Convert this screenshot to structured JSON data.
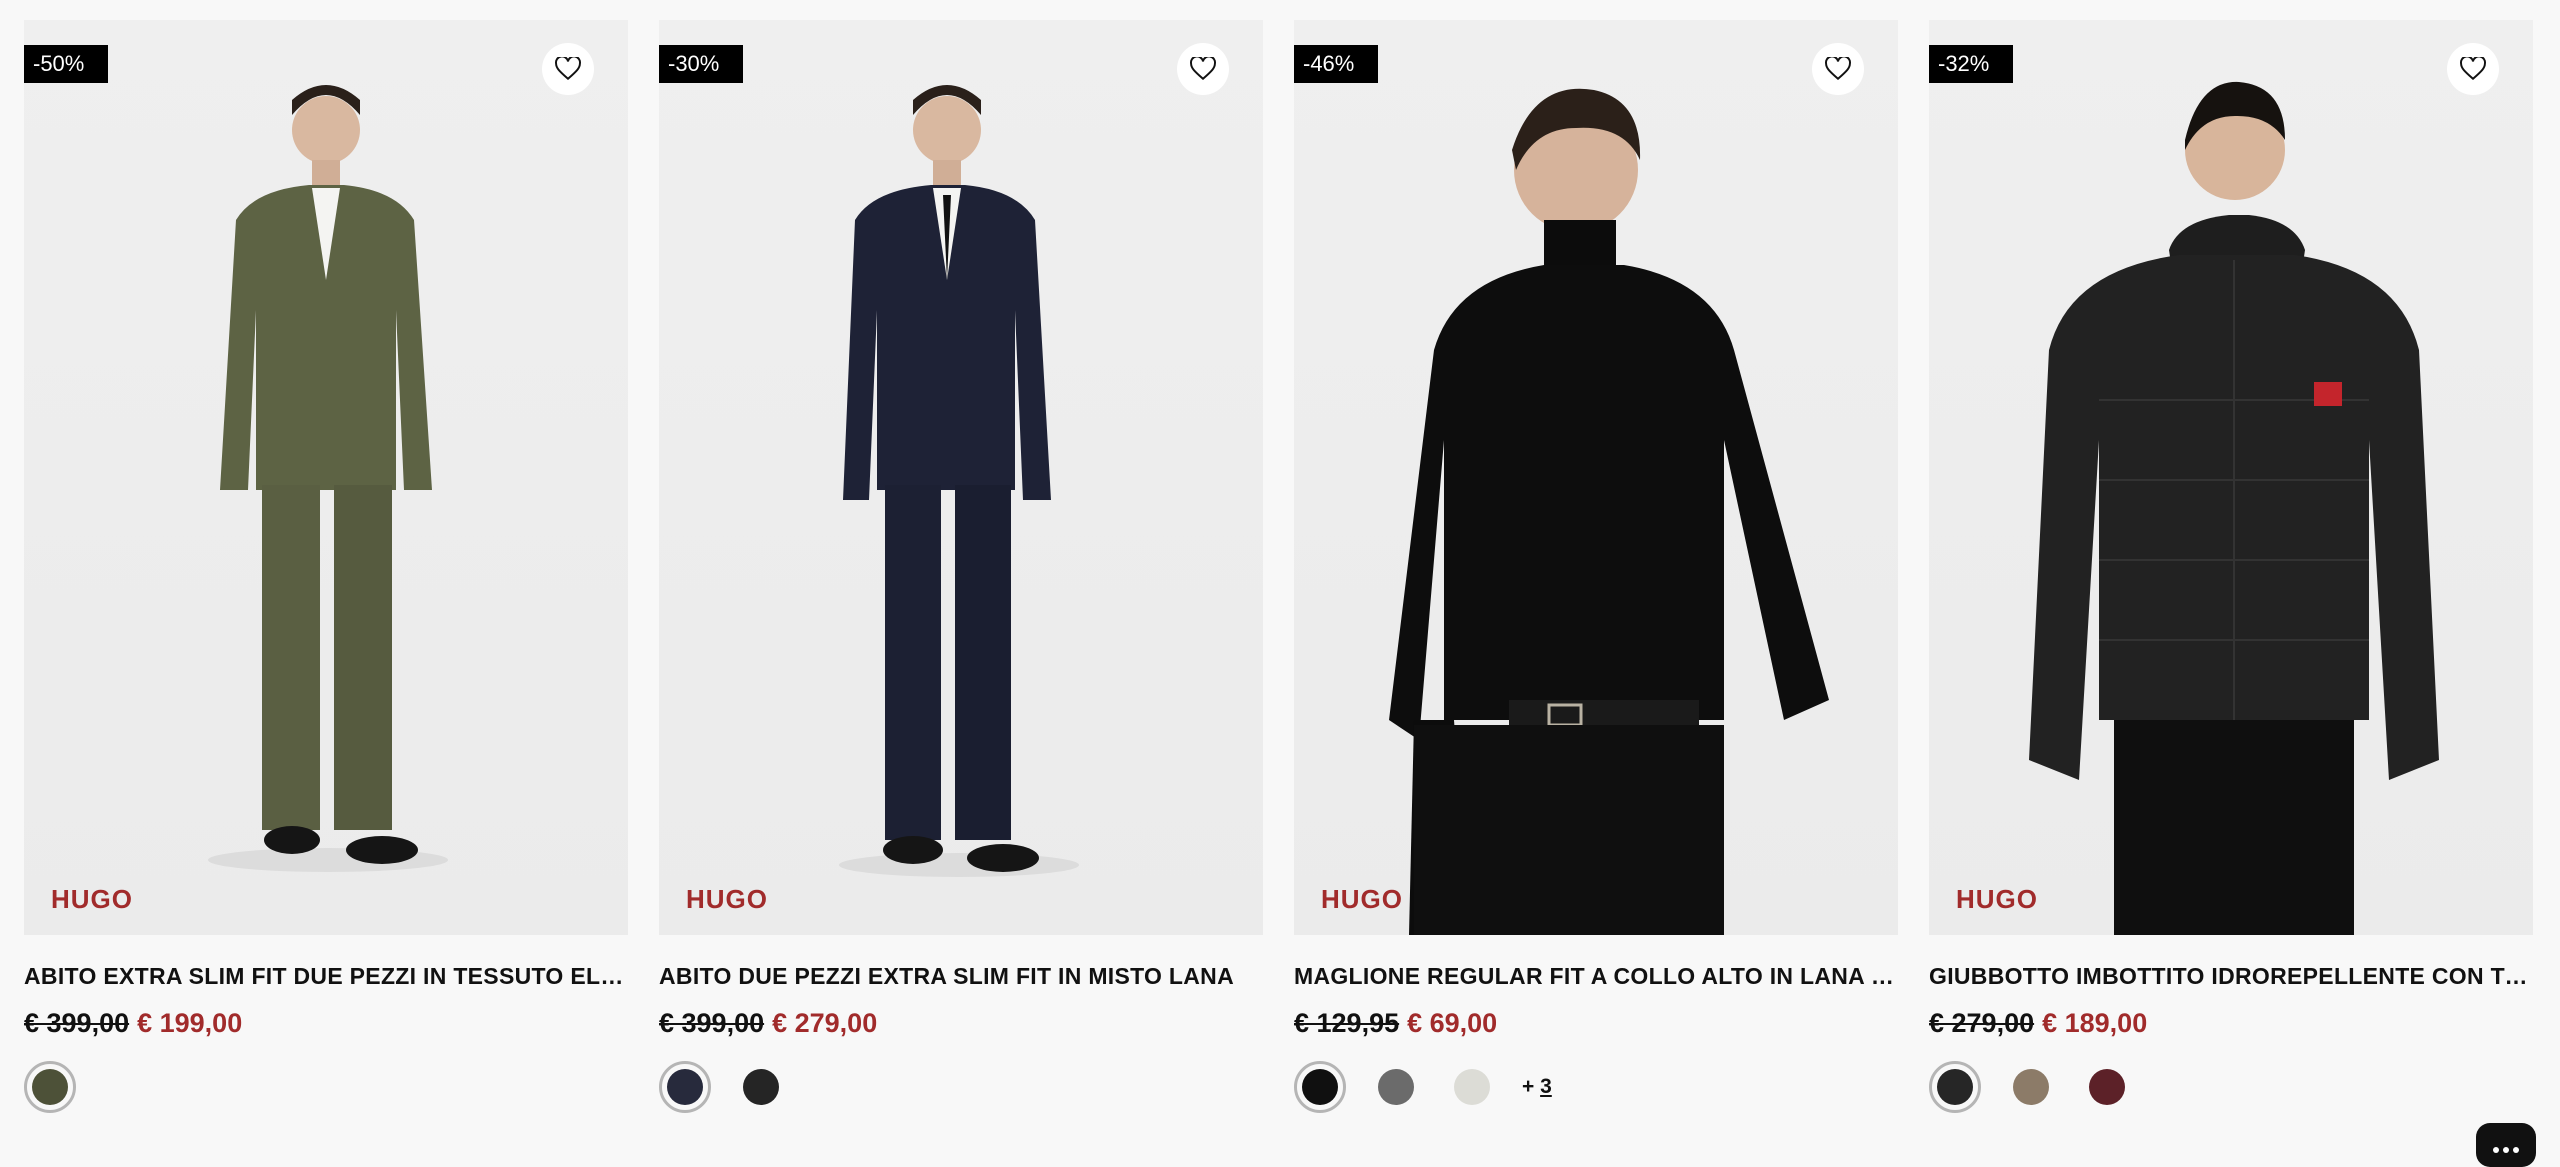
{
  "products": [
    {
      "badge": "-50%",
      "brand": "HUGO",
      "title": "ABITO EXTRA SLIM FIT DUE PEZZI IN TESSUTO ELASTICO",
      "old_price": "€ 399,00",
      "new_price": "€ 199,00",
      "colors": [
        "#4d5138"
      ],
      "more_label": ""
    },
    {
      "badge": "-30%",
      "brand": "HUGO",
      "title": "ABITO DUE PEZZI EXTRA SLIM FIT IN MISTO LANA",
      "old_price": "€ 399,00",
      "new_price": "€ 279,00",
      "colors": [
        "#272a3c",
        "#252525"
      ],
      "more_label": ""
    },
    {
      "badge": "-46%",
      "brand": "HUGO",
      "title": "MAGLIONE REGULAR FIT A COLLO ALTO IN LANA VERGINE",
      "old_price": "€ 129,95",
      "new_price": "€ 69,00",
      "colors": [
        "#101010",
        "#6b6b6b",
        "#dcdcd6"
      ],
      "more_label": "+ ",
      "more_count": "3"
    },
    {
      "badge": "-32%",
      "brand": "HUGO",
      "title": "GIUBBOTTO IMBOTTITO IDROREPELLENTE CON TOPPA LOGO",
      "old_price": "€ 279,00",
      "new_price": "€ 189,00",
      "colors": [
        "#262626",
        "#8c7b68",
        "#5c2128"
      ],
      "more_label": ""
    }
  ],
  "icons": {
    "wishlist": "heart-outline-icon",
    "chat": "chat-bubble-icon"
  }
}
